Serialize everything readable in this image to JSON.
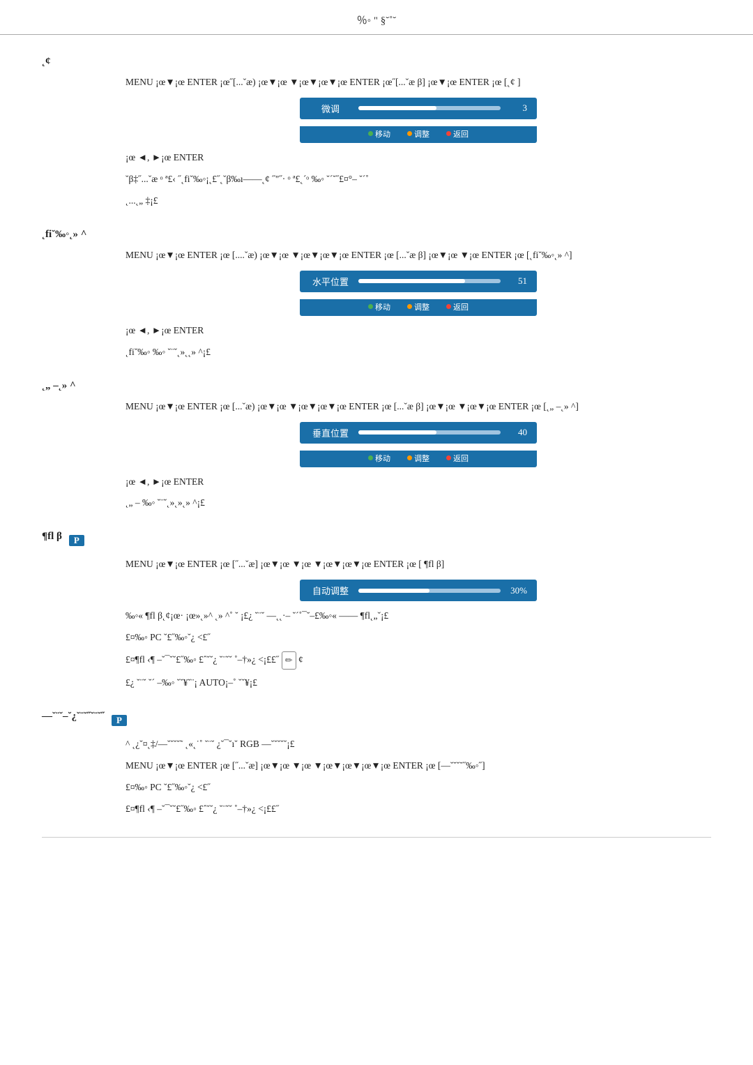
{
  "header": {
    "title": "％◦ \" §˘˚˘"
  },
  "sections": [
    {
      "id": "section-fine-tune",
      "title": "˛¢",
      "body1": "MENU ¡œ▼¡œ ENTER ¡œ˝[...ˇæ) ¡œ▼¡œ ▼¡œ▼¡œ▼¡œ ENTER ¡œ˝[...ˇæ  β]  ¡œ▼¡œ ENTER ¡œ [˛¢    ]",
      "slider": {
        "label": "微调",
        "value": "3",
        "fill_pct": 55,
        "controls": [
          "移动",
          "调整",
          "返回"
        ]
      },
      "body2": "¡œ ◄,  ►¡œ ENTER",
      "body3": "˘β‡˝...ˇæ ᵒ ª£‹ ˝˛fi˘‰◦¡˛£˝˛ˇβ‰ı——˛¢ ˝\"˝·  ᵒ ª£˛ˊᵒ  ‰◦ ˘´˘˝£¤°– ˘´˚",
      "body3b": "˛...˛„ ‡¡£"
    },
    {
      "id": "section-h-position",
      "title": "˛fi˘‰◦˛» ^",
      "body1": "MENU ¡œ▼¡œ ENTER ¡œ [....ˇæ) ¡œ▼¡œ ▼¡œ▼¡œ▼¡œ ENTER ¡œ [...ˇæ  β]  ¡œ▼¡œ ▼¡œ ENTER ¡œ [˛fi˘‰◦˛» ^]",
      "slider": {
        "label": "水平位置",
        "value": "51",
        "fill_pct": 75,
        "controls": [
          "移动",
          "调整",
          "返回"
        ]
      },
      "body2": "¡œ ◄,  ►¡œ ENTER",
      "body3": "˛fi˘‰◦ ‰◦ ˘¨˘˛»˛˛» ^¡£"
    },
    {
      "id": "section-v-position",
      "title": "˛„ –˛» ^",
      "body1": "MENU ¡œ▼¡œ ENTER ¡œ [...ˇæ) ¡œ▼¡œ ▼¡œ▼¡œ▼¡œ ENTER ¡œ [...ˇæ  β]  ¡œ▼¡œ ▼¡œ▼¡œ ENTER ¡œ [˛„ –˛» ^]",
      "slider": {
        "label": "垂直位置",
        "value": "40",
        "fill_pct": 55,
        "controls": [
          "移动",
          "调整",
          "返回"
        ]
      },
      "body2": "¡œ ◄,  ►¡œ ENTER",
      "body3": "˛„ – ‰◦ ˘¨˘˛»˛»˛» ^¡£"
    },
    {
      "id": "section-auto",
      "title_parts": [
        "¶fl  β",
        "P"
      ],
      "body1": "MENU ¡œ▼¡œ ENTER ¡œ [˝...ˇæ] ¡œ▼¡œ ▼¡œ ▼¡œ▼¡œ▼¡œ ENTER ¡œ [ ¶fl  β]",
      "slider": {
        "label": "自动调整",
        "value": "30%",
        "fill_pct": 50,
        "controls": []
      },
      "note1": "‰◦«  ¶fl  β˛¢¡œ·  ¡œ»˛»^ ˛» ^˚ ˘ ¡£¿ ˘¨˘  —˛˛·– ˘´˚¯˘–£‰◦«  ——  ¶fl˛„ˇ¡£",
      "note2": "£¤‰◦  PC ˘£˝‰◦˘¿ ˂£˝",
      "note3": "£¤¶fl ‹¶ –˘¯ˇ˘£˝‰◦ £ˆˇ˘¿ ˘¨˘ˇ ˚–†»¿ ˂¡££˝",
      "note3_icon": "✏",
      "note4": "£¿ ˘¨˘ ˘´ –‰◦  ˘ˇ¥˘¨¡ AUTO¡–˚ ˘ˇ¥¡£"
    },
    {
      "id": "section-rgb",
      "title_parts": [
        "—˘¨˘–˘¿˘¨˘˝",
        "P"
      ],
      "body0": "^   ˛¿˘¤˛‡/—˘˘˘˘˜ ˛«˛˙˚ ˘¨˘ ¿˘¯˘ı˘ RGB —˘˘˘˘˘¡£",
      "body1": "MENU ¡œ▼¡œ ENTER ¡œ [˝...ˇæ] ¡œ▼¡œ ▼¡œ ▼¡œ▼¡œ▼¡œ▼¡œ ENTER ¡œ [—˘˘˘˘˝‰◦˝]",
      "note2": "£¤‰◦  PC ˘£˝‰◦˘¿ ˂£˝",
      "note3": "£¤¶fl ‹¶ –˘¯ˇ˘£˝‰◦ £ˆˇ˘¿ ˘¨˘ˇ ˚–†»¿ ˂¡££˝"
    }
  ],
  "colors": {
    "accent": "#1a6fa8",
    "fill": "#a0c4e0",
    "white": "#ffffff",
    "green": "#4caf50",
    "orange": "#ff9800",
    "red": "#f44336"
  }
}
